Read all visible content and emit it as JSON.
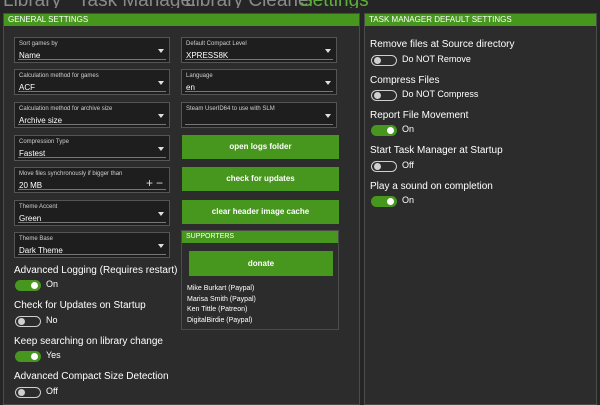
{
  "tabs": {
    "library": "Library",
    "task_manager": "Task Manager",
    "library_cleaner": "Library Cleaner",
    "settings": "Settings"
  },
  "general": {
    "header": "GENERAL SETTINGS",
    "sort_games": {
      "label": "Sort games by",
      "value": "Name"
    },
    "calc_games": {
      "label": "Calculation method for games",
      "value": "ACF"
    },
    "calc_archive": {
      "label": "Calculation method for archive size",
      "value": "Archive size"
    },
    "compression": {
      "label": "Compression Type",
      "value": "Fastest"
    },
    "sync_move": {
      "label": "Move files synchronously if bigger than",
      "value": "20 MB"
    },
    "theme_accent": {
      "label": "Theme Accent",
      "value": "Green"
    },
    "theme_base": {
      "label": "Theme Base",
      "value": "Dark Theme"
    },
    "default_compact": {
      "label": "Default Compact Level",
      "value": "XPRESS8K"
    },
    "language": {
      "label": "Language",
      "value": "en"
    },
    "steam_userid": {
      "label": "Steam UserID64 to use with SLM",
      "value": ""
    },
    "buttons": {
      "open_logs": "open logs folder",
      "check_updates": "check for updates",
      "clear_cache": "clear header image cache"
    },
    "toggles": {
      "advanced_logging": {
        "label": "Advanced Logging (Requires restart)",
        "state": "On"
      },
      "check_updates_startup": {
        "label": "Check for Updates on Startup",
        "state": "No"
      },
      "keep_searching": {
        "label": "Keep searching on library change",
        "state": "Yes"
      },
      "compact_detection": {
        "label": "Advanced Compact Size Detection",
        "state": "Off"
      }
    }
  },
  "supporters": {
    "header": "SUPPORTERS",
    "donate_label": "donate",
    "list": [
      "Mike Burkart (Paypal)",
      "Marisa Smith (Paypal)",
      "Ken Tittle (Patreon)",
      "DigitalBirdie (Paypal)"
    ]
  },
  "task_manager": {
    "header": "TASK MANAGER DEFAULT SETTINGS",
    "remove_files": {
      "label": "Remove files at Source directory",
      "state": "Do NOT Remove"
    },
    "compress_files": {
      "label": "Compress Files",
      "state": "Do NOT Compress"
    },
    "report_movement": {
      "label": "Report File Movement",
      "state": "On"
    },
    "start_tm": {
      "label": "Start Task Manager at Startup",
      "state": "Off"
    },
    "play_sound": {
      "label": "Play a sound on completion",
      "state": "On"
    }
  },
  "icons": {
    "stepper_increase": "plus-icon",
    "stepper_decrease": "minus-icon",
    "dropdown": "chevron-down-icon"
  },
  "colors": {
    "accent": "#47971f",
    "background": "#252525",
    "panel": "#2c2c2c"
  }
}
